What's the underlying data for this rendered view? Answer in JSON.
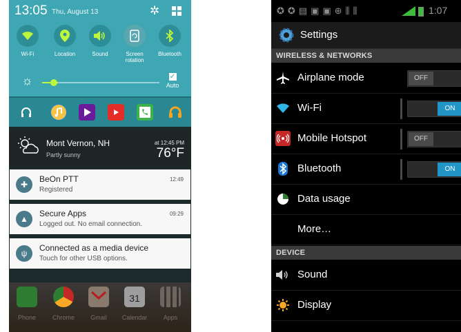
{
  "left": {
    "status": {
      "time": "13:05",
      "date": "Thu, August 13"
    },
    "toggles": [
      {
        "label": "Wi-Fi",
        "icon": "wifi-icon",
        "state": "on"
      },
      {
        "label": "Location",
        "icon": "location-icon",
        "state": "on"
      },
      {
        "label": "Sound",
        "icon": "sound-icon",
        "state": "on"
      },
      {
        "label": "Screen rotation",
        "icon": "screen-rotation-icon",
        "state": "off"
      },
      {
        "label": "Bluetooth",
        "icon": "bluetooth-icon",
        "state": "on"
      }
    ],
    "brightness": {
      "level": 0.1,
      "auto_label": "Auto"
    },
    "shortcut_icons": [
      "headphones-icon",
      "music-note-icon",
      "play-store-icon",
      "youtube-icon",
      "phone-icon",
      "headphones-orange-icon"
    ],
    "weather": {
      "city": "Mont Vernon, NH",
      "condition": "Partly sunny",
      "time": "at 12:45 PM",
      "temp": "76°F"
    },
    "notifications": [
      {
        "title": "BeOn PTT",
        "subtitle": "Registered",
        "time": "12:49",
        "icon": "beon-icon"
      },
      {
        "title": "Secure Apps",
        "subtitle": "Logged out. No email connection.",
        "time": "09:29",
        "icon": "warning-icon"
      },
      {
        "title": "Connected as a media device",
        "subtitle": "Touch for other USB options.",
        "time": "",
        "icon": "usb-icon"
      }
    ],
    "dock": [
      {
        "label": "Phone",
        "icon": "phone-icon"
      },
      {
        "label": "Chrome",
        "icon": "chrome-icon"
      },
      {
        "label": "Gmail",
        "icon": "gmail-icon"
      },
      {
        "label": "Calendar",
        "icon": "calendar-icon",
        "day": "31"
      },
      {
        "label": "Apps",
        "icon": "apps-grid-icon"
      }
    ]
  },
  "right": {
    "status": {
      "time": "1:07"
    },
    "header": {
      "title": "Settings"
    },
    "sections": [
      {
        "title": "WIRELESS & NETWORKS"
      },
      {
        "title": "DEVICE"
      }
    ],
    "rows": [
      {
        "label": "Airplane mode",
        "icon": "airplane-icon",
        "toggle": "OFF"
      },
      {
        "label": "Wi-Fi",
        "icon": "wifi-icon",
        "toggle": "ON"
      },
      {
        "label": "Mobile Hotspot",
        "icon": "hotspot-icon",
        "toggle": "OFF"
      },
      {
        "label": "Bluetooth",
        "icon": "bluetooth-icon",
        "toggle": "ON"
      },
      {
        "label": "Data usage",
        "icon": "data-usage-icon"
      },
      {
        "label": "More…",
        "icon": ""
      },
      {
        "label": "Sound",
        "icon": "speaker-icon"
      },
      {
        "label": "Display",
        "icon": "display-icon"
      }
    ]
  }
}
